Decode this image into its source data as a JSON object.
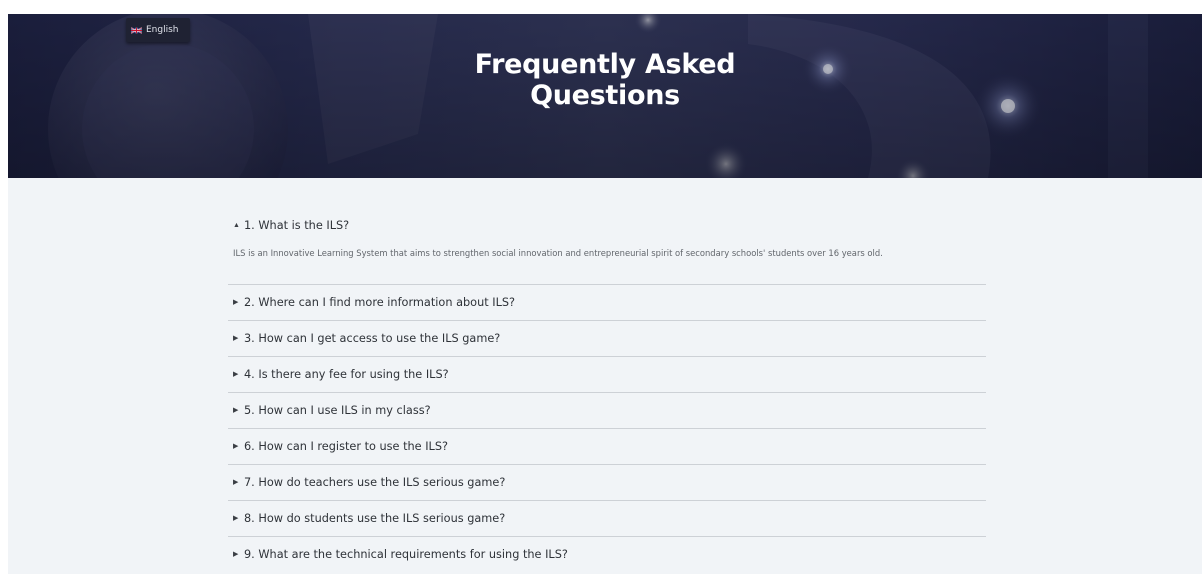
{
  "language_selector": {
    "label": "English",
    "flag_icon": "uk-flag-icon"
  },
  "hero": {
    "title": "Frequently Asked Questions"
  },
  "faq": {
    "items": [
      {
        "question": "1. What is the ILS?",
        "expanded": true,
        "answer": "ILS is an Innovative Learning System that aims to strengthen social innovation and entrepreneurial spirit of secondary schools' students over 16 years old."
      },
      {
        "question": "2. Where can I find more information about ILS?",
        "expanded": false
      },
      {
        "question": "3. How can I get access to use the ILS game?",
        "expanded": false
      },
      {
        "question": "4. Is there any fee for using the ILS?",
        "expanded": false
      },
      {
        "question": "5. How can I use ILS in my class?",
        "expanded": false
      },
      {
        "question": "6. How can I register to use the ILS?",
        "expanded": false
      },
      {
        "question": "7. How do teachers use the ILS serious game?",
        "expanded": false
      },
      {
        "question": "8. How do students use the ILS serious game?",
        "expanded": false
      },
      {
        "question": "9. What are the technical requirements for using the ILS?",
        "expanded": false
      }
    ]
  },
  "icons": {
    "expanded": "caret-up-icon",
    "collapsed": "caret-right-icon"
  },
  "colors": {
    "hero_dark": "#1f2346",
    "page_background": "#f1f4f7",
    "question_text": "#2e3238",
    "answer_text": "#62666c",
    "divider": "#cdd1d6"
  }
}
